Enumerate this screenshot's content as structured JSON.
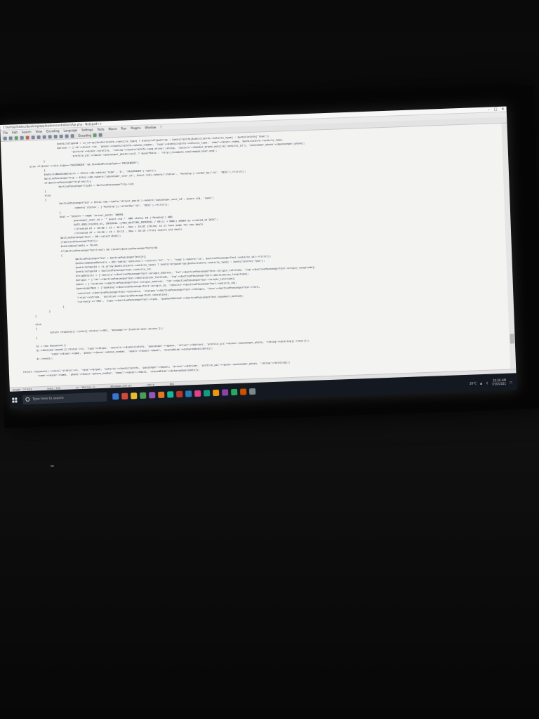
{
  "window": {
    "title": "c:\\xampp\\htdocs\\booking\\application\\controllers\\Api.php - Notepad++",
    "menu": [
      "File",
      "Edit",
      "Search",
      "View",
      "Encoding",
      "Language",
      "Settings",
      "Tools",
      "Macro",
      "Run",
      "Plugins",
      "Window",
      "?"
    ],
    "toolbar_label": "Encoding"
  },
  "code": [
    {
      "indent": 80,
      "text": "$vehicleTypeId = is_array($vehicleInfo->vehicle_type) ? $vehicleTypeArray : $vehicleInfo[$vehicleInfo->vehicle_type] : $vehicleInfo['Type'];"
    },
    {
      "indent": 80,
      "text": "$driver = ['id'=>$user->id, 'phone'=>$vehicleInfo->phone_number, 'type'=>$vehicleInfo->vehicle_type, 'name'=>$user->name, $vehicleInfo->vehicle_type,"
    },
    {
      "indent": 100,
      "text": "'picture'=>$user->profile, 'rating'=>$vehicleInfo->avg_driver_rating, 'vehicle'=>$model_brand_vehicle['vehicle_id'], 'passenger_phone'=>$passenger_phone];"
    },
    {
      "indent": 100,
      "text": "'profile_pic'=>$user->passenger_photo!=null ? $userPhoto : 'http://example.com/images/user.png';"
    },
    {
      "indent": 60,
      "text": "}"
    },
    {
      "indent": 40,
      "text": "else if($user->role_type=='PASSENGER' && $loadedPickupType=='PASSENGER')"
    },
    {
      "indent": 60,
      "text": "{"
    },
    {
      "indent": 60,
      "text": "$vehicleBookedDetails = $this->db->where('type', '0', 'PASSENGER')->get();"
    },
    {
      "indent": 60,
      "text": "$activePassengerTrip = $this->db->where('passenger_user_id', $user->id)->where('status', 'Pending')->order_by('id', 'DESC')->first();"
    },
    {
      "indent": 60,
      "text": "if($activePassengerTrip!=null){"
    },
    {
      "indent": 80,
      "text": "$activePassengerTripId = $activePassengerTrip->id;"
    },
    {
      "indent": 60,
      "text": "}"
    },
    {
      "indent": 60,
      "text": "else"
    },
    {
      "indent": 60,
      "text": "{"
    },
    {
      "indent": 80,
      "text": "$activePassengerTest = $this->db->table('driver_posts')->where('passenger_user_id', $user->id, 'none')"
    },
    {
      "indent": 100,
      "text": "->where('status', ['Pending'])->orderBy('id', 'DESC')->first();"
    },
    {
      "indent": 80,
      "text": "}"
    },
    {
      "indent": 80,
      "text": "$sql = \"SELECT * FROM `driver_posts` WHERE"
    },
    {
      "indent": 100,
      "text": "passenger_user_id = '\".$user->id.\"' AND status IN ('Pending') AND"
    },
    {
      "indent": 100,
      "text": "DATE_ADD(created_at, INTERVAL ((MAX_WAITING_INTERVAL / 60))) > NOW() ORDER by created_at DESC\";"
    },
    {
      "indent": 100,
      "text": "//Created AT = 10:00 + 15 = 10:15 , Now = 10:05 (False) so it have page for new deals"
    },
    {
      "indent": 100,
      "text": "//Created AT = 10:00 + 15 = 10:15 , Now = 10:16 (True) expire old deals"
    },
    {
      "indent": 80,
      "text": "$activePassengerTest = DB::select($sql);"
    },
    {
      "indent": 80,
      "text": "//$activePassengerTest();"
    },
    {
      "indent": 80,
      "text": "$sharedAvailable = false;"
    },
    {
      "indent": 80,
      "text": "if($activePassengerTest!=null && sizeof($activePassengerTest)>0)"
    },
    {
      "indent": 80,
      "text": "{"
    },
    {
      "indent": 100,
      "text": "$activePassengerTest = $activePassengerTest[0];"
    },
    {
      "indent": 100,
      "text": "$vehicleBookedDetails = DB::table('vehicles')->select('id', 'v', 'type')->where('id', $activePassengerTest->vehicle_id)->first();"
    },
    {
      "indent": 100,
      "text": "$vehicleTypeId = is_array($vehicleInfo->vehicle_type) ? $vehicleTypeArray[$vehicleInfo->vehicle_type] : $vehicleInfo['Type'];"
    },
    {
      "indent": 100,
      "text": "$vehicleTypeId = $activePassengerTest->vehicle_id;"
    },
    {
      "indent": 100,
      "text": "$tripDetails = ['vehicle'=>$activePassengerTest->origin_address, 'lat'=>$activePassengerTest->origin_latitude, 'lng'=>$activePassengerTest->origin_longitude];"
    },
    {
      "indent": 100,
      "text": "$origin = ['lat'=>$activePassengerTest->destination_latitude, 'lng'=>$activePassengerTest->destination_longitude];"
    },
    {
      "indent": 100,
      "text": "$dest = ['location'=>$activePassengerTest->origin_address, 'lat'=>$activePassengerTest->origin_latitude];"
    },
    {
      "indent": 100,
      "text": "$passengerNum = ['booking'=>$activePassengerTest->origin_id, 'vehicle'=>$activePassengerTest->vehicle_id];"
    },
    {
      "indent": 100,
      "text": "'vehicles'=>$activePassengerTest->distance, 'charges'=>$activePassengerTest->charges, 'fare'=>$activePassengerTest->fare,"
    },
    {
      "indent": 100,
      "text": "'trips'=>$trips, 'duration'=>$activePassengerTest->duration];"
    },
    {
      "indent": 100,
      "text": "'currency'=>'PKR', 'type'=>$activePassengerTest->type, 'paymentMethod'=>$activePassengerTest->payment_method];"
    },
    {
      "indent": 80,
      "text": "}"
    },
    {
      "indent": 60,
      "text": "}"
    },
    {
      "indent": 40,
      "text": "}"
    },
    {
      "indent": 40,
      "text": ""
    },
    {
      "indent": 40,
      "text": "else"
    },
    {
      "indent": 40,
      "text": "{"
    },
    {
      "indent": 60,
      "text": "return response()->json(['status'=>401, 'message'=>'Invalid User Access']);"
    },
    {
      "indent": 40,
      "text": "}"
    },
    {
      "indent": 40,
      "text": ""
    },
    {
      "indent": 40,
      "text": "$j = new Response();"
    },
    {
      "indent": 40,
      "text": "$j->data($d->model(['status'=>1, 'type'=>$type, 'vehicle'=>$vehicleInfo, 'passenger'=>$pass, 'driver'=>$driver, 'profile_pic'=>$user->passenger_photo, 'rating'=>$rating])->save());"
    },
    {
      "indent": 60,
      "text": "'name'=>$user->name, 'phone'=>$user->phone_number, 'email'=>$user->email, 'sharedRide'=>$sharedAvailable]);"
    },
    {
      "indent": 40,
      "text": "$j->send();"
    },
    {
      "indent": 40,
      "text": ""
    },
    {
      "indent": 40,
      "text": ""
    },
    {
      "indent": 20,
      "text": "return response()->json(['status'=>1, 'type'=>$type, 'vehicle'=>$vehicleInfo, 'passenger'=>$pass, 'driver'=>$driver, 'profile_pic'=>$user->passenger_photo, 'rating'=>$rating]);"
    },
    {
      "indent": 40,
      "text": "'name'=>$user->name, 'phone'=>$user->phone_number, 'email'=>$user->email, 'sharedRide'=>$sharedAvailable]);"
    }
  ],
  "status": {
    "length": "length : 27,923",
    "lines": "lines : 735",
    "position": "Ln : 380   Col : 1",
    "eol": "Windows (CR LF)",
    "encoding": "UTF-8",
    "mode": "INS"
  },
  "taskbar": {
    "search_placeholder": "Type here to search",
    "tray_temp": "26°C",
    "time": "10:26 AM",
    "date": "7/10/2021",
    "icon_colors": [
      "#3a7bd5",
      "#d94b3c",
      "#f0c330",
      "#4aa35a",
      "#9b59b6",
      "#e67e22",
      "#1abc9c",
      "#c0392b",
      "#2980b9",
      "#e84393",
      "#16a085",
      "#f39c12",
      "#8e44ad",
      "#27ae60",
      "#d35400",
      "#7f8c8d"
    ]
  }
}
